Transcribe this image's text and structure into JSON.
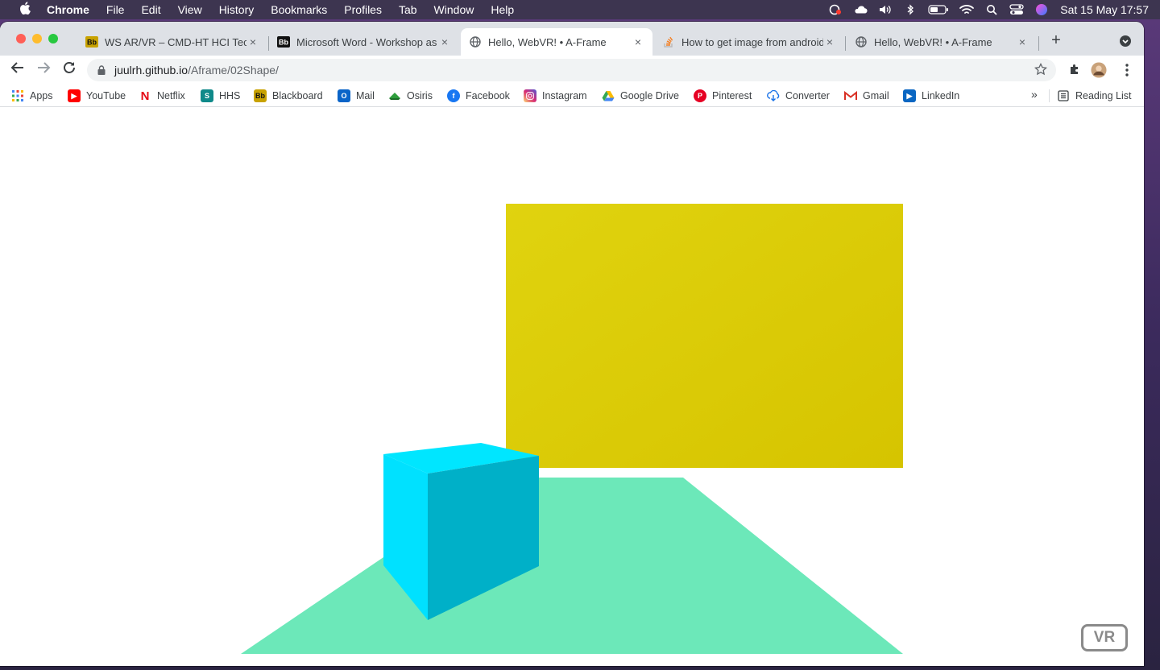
{
  "menubar": {
    "app_name": "Chrome",
    "items": [
      "File",
      "Edit",
      "View",
      "History",
      "Bookmarks",
      "Profiles",
      "Tab",
      "Window",
      "Help"
    ],
    "clock": "Sat 15 May  17:57"
  },
  "tabs": [
    {
      "title": "WS AR/VR – CMD-HT HCI Tech",
      "favicon": "blackboard-icon",
      "active": false
    },
    {
      "title": "Microsoft Word - Workshop as",
      "favicon": "blackboard-icon",
      "active": false
    },
    {
      "title": "Hello, WebVR! • A-Frame",
      "favicon": "globe-icon",
      "active": true
    },
    {
      "title": "How to get image from android",
      "favicon": "stackoverflow-icon",
      "active": false
    },
    {
      "title": "Hello, WebVR! • A-Frame",
      "favicon": "globe-icon",
      "active": false
    }
  ],
  "close_glyph": "×",
  "newtab_glyph": "+",
  "address": {
    "host": "juulrh.github.io",
    "path": "/Aframe/02Shape/"
  },
  "bookmarks": {
    "items": [
      {
        "label": "Apps",
        "color": "#4285f4"
      },
      {
        "label": "YouTube",
        "color": "#ff0000"
      },
      {
        "label": "Netflix",
        "color": "#e50914"
      },
      {
        "label": "HHS",
        "color": "#0f8a8a"
      },
      {
        "label": "Blackboard",
        "color": "#111111"
      },
      {
        "label": "Mail",
        "color": "#0a64c8"
      },
      {
        "label": "Osiris",
        "color": "#2e9e3c"
      },
      {
        "label": "Facebook",
        "color": "#1877f2"
      },
      {
        "label": "Instagram",
        "color": "#d62976"
      },
      {
        "label": "Google Drive",
        "color": "#fbbc04"
      },
      {
        "label": "Pinterest",
        "color": "#e60023"
      },
      {
        "label": "Converter",
        "color": "#1a73e8"
      },
      {
        "label": "Gmail",
        "color": "#d93025"
      },
      {
        "label": "LinkedIn",
        "color": "#0a66c2"
      }
    ],
    "more_glyph": "»",
    "reading_list": "Reading List"
  },
  "scene": {
    "sky_color": "#ffffff",
    "plane_color": "#6ce8b9",
    "box_front_color": "#00e1ff",
    "box_side_color": "#00b0c8",
    "box_top_color": "#00e6ff",
    "wall_color": "#dcc900"
  },
  "vr_button": {
    "label": "VR"
  }
}
